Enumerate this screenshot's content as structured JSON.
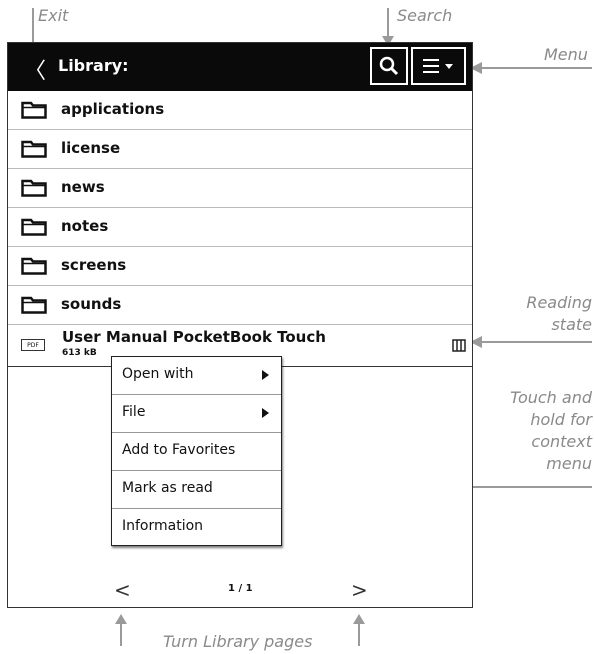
{
  "annotations": {
    "exit": "Exit",
    "search": "Search",
    "menu": "Menu",
    "reading_state": [
      "Reading",
      "state"
    ],
    "context_menu": [
      "Touch and",
      "hold for",
      "context",
      "menu"
    ],
    "turn_pages": "Turn Library pages"
  },
  "header": {
    "back_glyph": "〈",
    "title": "Library:"
  },
  "folders": [
    {
      "label": "applications"
    },
    {
      "label": "license"
    },
    {
      "label": "news"
    },
    {
      "label": "notes"
    },
    {
      "label": "screens"
    },
    {
      "label": "sounds"
    }
  ],
  "book": {
    "format_badge": "PDF",
    "title": "User Manual PocketBook Touch",
    "size": "613 kB"
  },
  "context_menu": [
    {
      "label": "Open with",
      "submenu": true
    },
    {
      "label": "File",
      "submenu": true
    },
    {
      "label": "Add to Favorites",
      "submenu": false
    },
    {
      "label": "Mark as read",
      "submenu": false
    },
    {
      "label": "Information",
      "submenu": false
    }
  ],
  "pager": {
    "prev_glyph": "<",
    "page": "1 / 1",
    "next_glyph": ">"
  },
  "colors": {
    "topbar": "#0a0a0a",
    "annotation": "#8a8a8a",
    "callout_line": "#9a9a9a"
  },
  "icons": {
    "back": "chevron-left-icon",
    "search": "search-icon",
    "menu": "hamburger-menu-icon",
    "folder": "folder-icon",
    "reading_state": "book-state-icon"
  }
}
